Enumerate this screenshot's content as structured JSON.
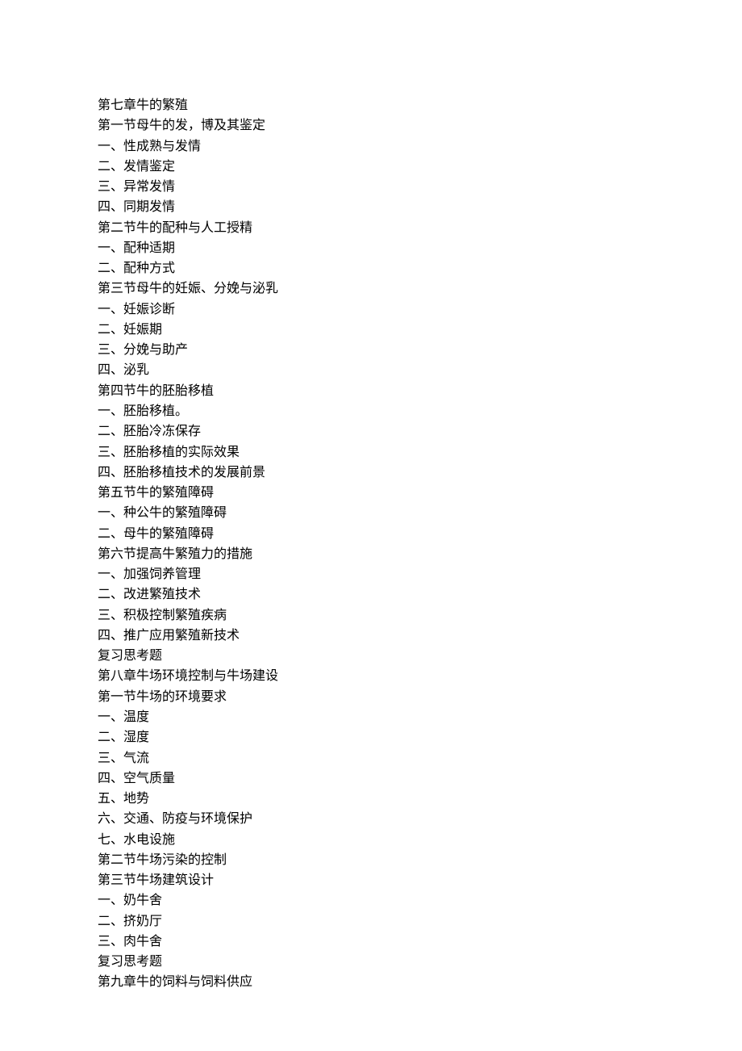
{
  "lines": [
    "第七章牛的繁殖",
    "第一节母牛的发，博及其鉴定",
    "一、性成熟与发情",
    "二、发情鉴定",
    "三、异常发情",
    "四、同期发情",
    "第二节牛的配种与人工授精",
    "一、配种适期",
    "二、配种方式",
    "第三节母牛的妊娠、分娩与泌乳",
    "一、妊娠诊断",
    "二、妊娠期",
    "三、分娩与助产",
    "四、泌乳",
    "第四节牛的胚胎移植",
    "一、胚胎移植。",
    "二、胚胎冷冻保存",
    "三、胚胎移植的实际效果",
    "四、胚胎移植技术的发展前景",
    "第五节牛的繁殖障碍",
    "一、种公牛的繁殖障碍",
    "二、母牛的繁殖障碍",
    "第六节提高牛繁殖力的措施",
    "一、加强饲养管理",
    "二、改进繁殖技术",
    "三、积极控制繁殖疾病",
    "四、推广应用繁殖新技术",
    "复习思考题",
    "第八章牛场环境控制与牛场建设",
    "第一节牛场的环境要求",
    "一、温度",
    "二、湿度",
    "三、气流",
    "四、空气质量",
    "五、地势",
    "六、交通、防疫与环境保护",
    "七、水电设施",
    "第二节牛场污染的控制",
    "第三节牛场建筑设计",
    "一、奶牛舍",
    "二、挤奶厅",
    "三、肉牛舍",
    "复习思考题",
    "第九章牛的饲料与饲料供应"
  ]
}
